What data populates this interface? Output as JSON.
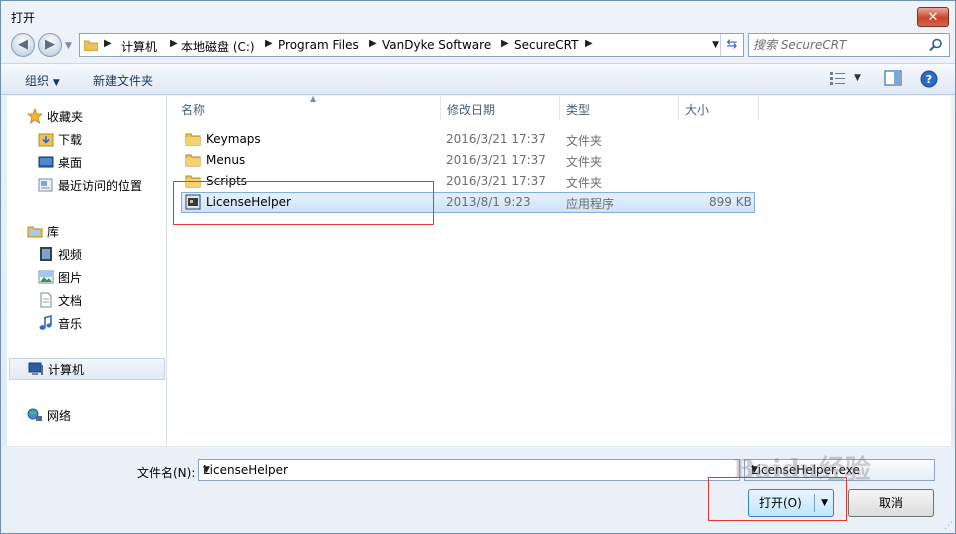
{
  "window": {
    "title": "打开",
    "close_label": "✕"
  },
  "address": {
    "crumbs": [
      "计算机",
      "本地磁盘 (C:)",
      "Program Files",
      "VanDyke Software",
      "SecureCRT"
    ]
  },
  "search": {
    "placeholder": "搜索 SecureCRT"
  },
  "toolbar": {
    "organize": "组织",
    "new_folder": "新建文件夹"
  },
  "sidebar": {
    "favorites": {
      "label": "收藏夹",
      "items": [
        "下载",
        "桌面",
        "最近访问的位置"
      ]
    },
    "libraries": {
      "label": "库",
      "items": [
        "视频",
        "图片",
        "文档",
        "音乐"
      ]
    },
    "computer": "计算机",
    "network": "网络"
  },
  "columns": {
    "name": "名称",
    "date": "修改日期",
    "type": "类型",
    "size": "大小"
  },
  "files": [
    {
      "name": "Keymaps",
      "date": "2016/3/21 17:37",
      "type": "文件夹",
      "size": "",
      "icon": "folder-icon"
    },
    {
      "name": "Menus",
      "date": "2016/3/21 17:37",
      "type": "文件夹",
      "size": "",
      "icon": "folder-icon"
    },
    {
      "name": "Scripts",
      "date": "2016/3/21 17:37",
      "type": "文件夹",
      "size": "",
      "icon": "folder-icon"
    },
    {
      "name": "LicenseHelper",
      "date": "2013/8/1 9:23",
      "type": "应用程序",
      "size": "899 KB",
      "icon": "application-icon"
    }
  ],
  "footer": {
    "filename_label": "文件名(N):",
    "filename_value": "LicenseHelper",
    "filter_value": "LicenseHelper.exe",
    "open_label": "打开(O)",
    "cancel_label": "取消"
  },
  "watermark": "Baidu经验",
  "colors": {
    "accent": "#3c7fb1",
    "highlight_box": "#ee3333"
  }
}
